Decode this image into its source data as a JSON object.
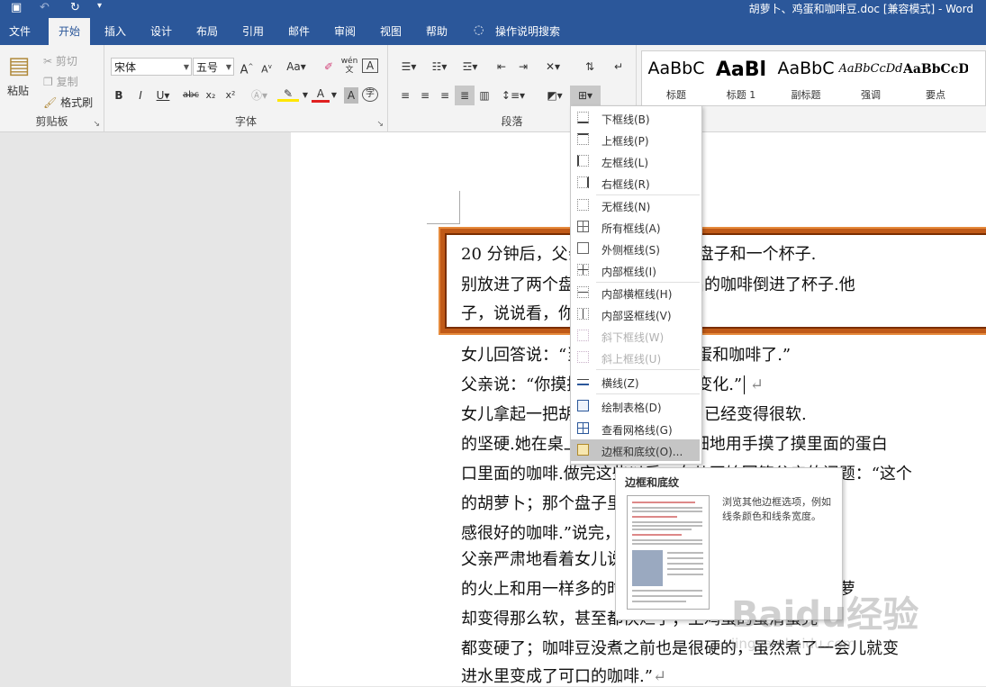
{
  "titlebar": {
    "title": "胡萝卜、鸡蛋和咖啡豆.doc [兼容模式] - Word"
  },
  "tabs": [
    {
      "label": "文件"
    },
    {
      "label": "开始"
    },
    {
      "label": "插入"
    },
    {
      "label": "设计"
    },
    {
      "label": "布局"
    },
    {
      "label": "引用"
    },
    {
      "label": "邮件"
    },
    {
      "label": "审阅"
    },
    {
      "label": "视图"
    },
    {
      "label": "帮助"
    }
  ],
  "tell_me": "操作说明搜索",
  "clipboard": {
    "paste": "粘贴",
    "cut": "剪切",
    "copy": "复制",
    "format_painter": "格式刷",
    "group": "剪贴板"
  },
  "font": {
    "name": "宋体",
    "size": "五号",
    "group": "字体"
  },
  "paragraph": {
    "group": "段落"
  },
  "styles": [
    {
      "preview": "AaBbC",
      "name": "标题"
    },
    {
      "preview": "AaBl",
      "name": "标题 1"
    },
    {
      "preview": "AaBbC",
      "name": "副标题"
    },
    {
      "preview": "AaBbCcDd",
      "name": "强调"
    },
    {
      "preview": "AaBbCcD",
      "name": "要点"
    }
  ],
  "document": {
    "lines": [
      "20 分钟后，父亲让女儿拿来两个盘子和一个杯子.",
      "别放进了两个盘子，将咖啡豆煮出的咖啡倒进了杯子.他",
      "子，说说看，你见到了什么？”",
      "女儿回答说：“当然是胡萝卜、鸡蛋和咖啡了.”",
      "父亲说：“你摸摸看，看看有什么变化.”",
      "女儿拿起一把胡萝卜，发现胡萝卜已经变得很软.",
      "的坚硬.她在桌上把蛋壳敲破，仔细地用手摸了摸里面的蛋白",
      "口里面的咖啡.做完这些以后，女儿开始回答父亲的问题：“这个",
      "的胡萝卜；那个盘子里是蛋壳包已经凝固了的鸡",
      "感很好的咖啡.”说完，她问亲爱的爸爸，您为什",
      "父亲严肃地看着女儿说：“这三样东西是在一样大的锅",
      "的火上和用一样多的时间煮过的，反应却迥然不同.胡萝",
      "却变得那么软，甚至都快烂了；生鸡蛋的蛋清蛋壳一",
      "都变硬了；咖啡豆没煮之前也是很硬的，虽然煮了一会儿就变",
      "进水里变成了可口的咖啡.”"
    ],
    "para_mark": "↵"
  },
  "border_menu": {
    "items": [
      {
        "label": "下框线(B)",
        "icon": "bottom-border-icon",
        "disabled": false
      },
      {
        "label": "上框线(P)",
        "icon": "top-border-icon",
        "disabled": false
      },
      {
        "label": "左框线(L)",
        "icon": "left-border-icon",
        "disabled": false
      },
      {
        "label": "右框线(R)",
        "icon": "right-border-icon",
        "disabled": false
      },
      {
        "label": "无框线(N)",
        "icon": "no-border-icon",
        "disabled": false
      },
      {
        "label": "所有框线(A)",
        "icon": "all-borders-icon",
        "disabled": false
      },
      {
        "label": "外侧框线(S)",
        "icon": "outside-borders-icon",
        "disabled": false
      },
      {
        "label": "内部框线(I)",
        "icon": "inside-borders-icon",
        "disabled": false
      },
      {
        "label": "内部横框线(H)",
        "icon": "inside-horizontal-border-icon",
        "disabled": false
      },
      {
        "label": "内部竖框线(V)",
        "icon": "inside-vertical-border-icon",
        "disabled": false
      },
      {
        "label": "斜下框线(W)",
        "icon": "diagonal-down-border-icon",
        "disabled": true
      },
      {
        "label": "斜上框线(U)",
        "icon": "diagonal-up-border-icon",
        "disabled": true
      },
      {
        "label": "横线(Z)",
        "icon": "horizontal-line-icon",
        "disabled": false
      },
      {
        "label": "绘制表格(D)",
        "icon": "draw-table-icon",
        "disabled": false
      },
      {
        "label": "查看网格线(G)",
        "icon": "view-gridlines-icon",
        "disabled": false
      },
      {
        "label": "边框和底纹(O)...",
        "icon": "borders-shading-icon",
        "disabled": false
      }
    ]
  },
  "tooltip": {
    "title": "边框和底纹",
    "description": "浏览其他边框选项，例如线条颜色和线条宽度。"
  },
  "watermark": {
    "text": "Baidu经验",
    "sub": "jingyan.baidu.com"
  },
  "colors": {
    "accent": "#2b579a",
    "frame_outer": "#c05a18",
    "frame_inner": "#7a2e00",
    "font_color": "#e02020",
    "highlight": "#ffe600"
  }
}
